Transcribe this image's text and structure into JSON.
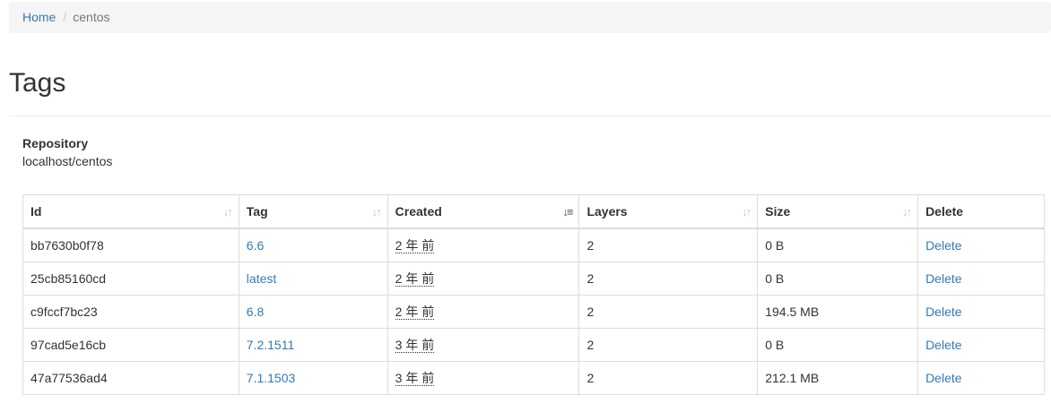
{
  "breadcrumb": {
    "home": "Home",
    "separator": "/",
    "current": "centos"
  },
  "page_title": "Tags",
  "repository": {
    "label": "Repository",
    "value": "localhost/centos"
  },
  "table": {
    "headers": {
      "id": "Id",
      "tag": "Tag",
      "created": "Created",
      "layers": "Layers",
      "size": "Size",
      "delete": "Delete"
    },
    "sort_icons": {
      "inactive": "↓↑",
      "active": "↓≡"
    },
    "rows": [
      {
        "id": "bb7630b0f78",
        "tag": "6.6",
        "created": "2 年 前",
        "layers": "2",
        "size": "0 B",
        "delete": "Delete"
      },
      {
        "id": "25cb85160cd",
        "tag": "latest",
        "created": "2 年 前",
        "layers": "2",
        "size": "0 B",
        "delete": "Delete"
      },
      {
        "id": "c9fccf7bc23",
        "tag": "6.8",
        "created": "2 年 前",
        "layers": "2",
        "size": "194.5 MB",
        "delete": "Delete"
      },
      {
        "id": "97cad5e16cb",
        "tag": "7.2.1511",
        "created": "3 年 前",
        "layers": "2",
        "size": "0 B",
        "delete": "Delete"
      },
      {
        "id": "47a77536ad4",
        "tag": "7.1.1503",
        "created": "3 年 前",
        "layers": "2",
        "size": "212.1 MB",
        "delete": "Delete"
      }
    ]
  },
  "colors": {
    "link": "#337ab7",
    "border": "#dddddd",
    "breadcrumb_bg": "#f5f5f5"
  }
}
